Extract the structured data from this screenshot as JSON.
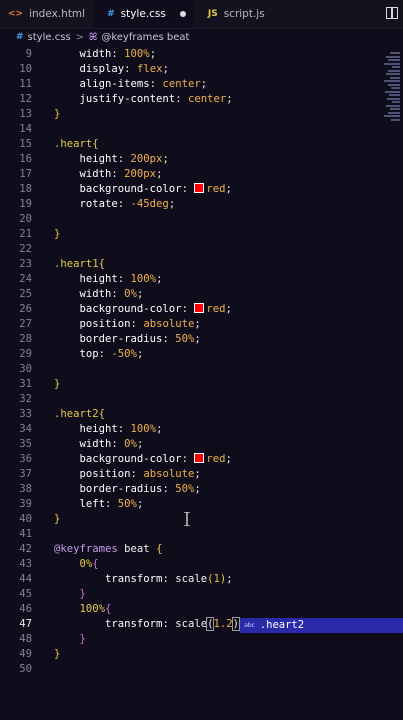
{
  "tabs": [
    {
      "label": "index.html",
      "icon": "html-icon",
      "glyph": "<>"
    },
    {
      "label": "style.css",
      "icon": "css-icon",
      "glyph": "#",
      "active": true,
      "modified": true
    },
    {
      "label": "script.js",
      "icon": "js-icon",
      "glyph": "JS"
    }
  ],
  "breadcrumb": {
    "file_glyph": "#",
    "file": "style.css",
    "separator": ">",
    "symbol_glyph": "ꕤ",
    "symbol": "@keyframes beat"
  },
  "suggestion": {
    "icon_text": "abc",
    "label": ".heart2"
  },
  "lines": [
    {
      "n": "9",
      "parts": [
        [
          "prop",
          "    width"
        ],
        [
          "punc",
          ": "
        ],
        [
          "val",
          "100%"
        ],
        [
          "punc",
          ";"
        ]
      ]
    },
    {
      "n": "10",
      "parts": [
        [
          "prop",
          "    display"
        ],
        [
          "punc",
          ": "
        ],
        [
          "val",
          "flex"
        ],
        [
          "punc",
          ";"
        ]
      ]
    },
    {
      "n": "11",
      "parts": [
        [
          "prop",
          "    align-items"
        ],
        [
          "punc",
          ": "
        ],
        [
          "val",
          "center"
        ],
        [
          "punc",
          ";"
        ]
      ]
    },
    {
      "n": "12",
      "parts": [
        [
          "prop",
          "    justify-content"
        ],
        [
          "punc",
          ": "
        ],
        [
          "val",
          "center"
        ],
        [
          "punc",
          ";"
        ]
      ]
    },
    {
      "n": "13",
      "parts": [
        [
          "brace",
          "}"
        ]
      ]
    },
    {
      "n": "14",
      "parts": []
    },
    {
      "n": "15",
      "parts": [
        [
          "sel",
          ".heart"
        ],
        [
          "brace",
          "{"
        ]
      ]
    },
    {
      "n": "16",
      "parts": [
        [
          "prop",
          "    height"
        ],
        [
          "punc",
          ": "
        ],
        [
          "val",
          "200px"
        ],
        [
          "punc",
          ";"
        ]
      ]
    },
    {
      "n": "17",
      "parts": [
        [
          "prop",
          "    width"
        ],
        [
          "punc",
          ": "
        ],
        [
          "val",
          "200px"
        ],
        [
          "punc",
          ";"
        ]
      ]
    },
    {
      "n": "18",
      "parts": [
        [
          "prop",
          "    background-color"
        ],
        [
          "punc",
          ": "
        ],
        [
          "swatch",
          ""
        ],
        [
          "val",
          "red"
        ],
        [
          "punc",
          ";"
        ]
      ]
    },
    {
      "n": "19",
      "parts": [
        [
          "prop",
          "    rotate"
        ],
        [
          "punc",
          ": "
        ],
        [
          "val",
          "-45deg"
        ],
        [
          "punc",
          ";"
        ]
      ]
    },
    {
      "n": "20",
      "parts": []
    },
    {
      "n": "21",
      "parts": [
        [
          "brace",
          "}"
        ]
      ]
    },
    {
      "n": "22",
      "parts": []
    },
    {
      "n": "23",
      "parts": [
        [
          "sel",
          ".heart1"
        ],
        [
          "brace",
          "{"
        ]
      ]
    },
    {
      "n": "24",
      "parts": [
        [
          "prop",
          "    height"
        ],
        [
          "punc",
          ": "
        ],
        [
          "val",
          "100%"
        ],
        [
          "punc",
          ";"
        ]
      ]
    },
    {
      "n": "25",
      "parts": [
        [
          "prop",
          "    width"
        ],
        [
          "punc",
          ": "
        ],
        [
          "val",
          "0%"
        ],
        [
          "punc",
          ";"
        ]
      ]
    },
    {
      "n": "26",
      "parts": [
        [
          "prop",
          "    background-color"
        ],
        [
          "punc",
          ": "
        ],
        [
          "swatch",
          ""
        ],
        [
          "val",
          "red"
        ],
        [
          "punc",
          ";"
        ]
      ]
    },
    {
      "n": "27",
      "parts": [
        [
          "prop",
          "    position"
        ],
        [
          "punc",
          ": "
        ],
        [
          "val",
          "absolute"
        ],
        [
          "punc",
          ";"
        ]
      ]
    },
    {
      "n": "28",
      "parts": [
        [
          "prop",
          "    border-radius"
        ],
        [
          "punc",
          ": "
        ],
        [
          "val",
          "50%"
        ],
        [
          "punc",
          ";"
        ]
      ]
    },
    {
      "n": "29",
      "parts": [
        [
          "prop",
          "    top"
        ],
        [
          "punc",
          ": "
        ],
        [
          "val",
          "-50%"
        ],
        [
          "punc",
          ";"
        ]
      ]
    },
    {
      "n": "30",
      "parts": []
    },
    {
      "n": "31",
      "parts": [
        [
          "brace",
          "}"
        ]
      ]
    },
    {
      "n": "32",
      "parts": []
    },
    {
      "n": "33",
      "parts": [
        [
          "sel",
          ".heart2"
        ],
        [
          "brace",
          "{"
        ]
      ]
    },
    {
      "n": "34",
      "parts": [
        [
          "prop",
          "    height"
        ],
        [
          "punc",
          ": "
        ],
        [
          "val",
          "100%"
        ],
        [
          "punc",
          ";"
        ]
      ]
    },
    {
      "n": "35",
      "parts": [
        [
          "prop",
          "    width"
        ],
        [
          "punc",
          ": "
        ],
        [
          "val",
          "0%"
        ],
        [
          "punc",
          ";"
        ]
      ]
    },
    {
      "n": "36",
      "parts": [
        [
          "prop",
          "    background-color"
        ],
        [
          "punc",
          ": "
        ],
        [
          "swatch",
          ""
        ],
        [
          "val",
          "red"
        ],
        [
          "punc",
          ";"
        ]
      ]
    },
    {
      "n": "37",
      "parts": [
        [
          "prop",
          "    position"
        ],
        [
          "punc",
          ": "
        ],
        [
          "val",
          "absolute"
        ],
        [
          "punc",
          ";"
        ]
      ]
    },
    {
      "n": "38",
      "parts": [
        [
          "prop",
          "    border-radius"
        ],
        [
          "punc",
          ": "
        ],
        [
          "val",
          "50%"
        ],
        [
          "punc",
          ";"
        ]
      ]
    },
    {
      "n": "39",
      "parts": [
        [
          "prop",
          "    left"
        ],
        [
          "punc",
          ": "
        ],
        [
          "val",
          "50%"
        ],
        [
          "punc",
          ";"
        ]
      ]
    },
    {
      "n": "40",
      "parts": [
        [
          "brace",
          "}"
        ]
      ]
    },
    {
      "n": "41",
      "parts": []
    },
    {
      "n": "42",
      "parts": [
        [
          "kw",
          "@keyframes "
        ],
        [
          "fn",
          "beat "
        ],
        [
          "brace",
          "{"
        ]
      ]
    },
    {
      "n": "43",
      "parts": [
        [
          "pct",
          "    0%"
        ],
        [
          "brace2",
          "{"
        ]
      ]
    },
    {
      "n": "44",
      "parts": [
        [
          "prop",
          "        transform"
        ],
        [
          "punc",
          ": "
        ],
        [
          "fn",
          "scale"
        ],
        [
          "brace",
          "("
        ],
        [
          "val",
          "1"
        ],
        [
          "brace",
          ")"
        ],
        [
          "punc",
          ";"
        ]
      ]
    },
    {
      "n": "45",
      "parts": [
        [
          "brace2",
          "    }"
        ]
      ]
    },
    {
      "n": "46",
      "parts": [
        [
          "pct",
          "    100%"
        ],
        [
          "brace2",
          "{"
        ]
      ]
    },
    {
      "n": "47",
      "parts": [
        [
          "prop",
          "        transform"
        ],
        [
          "punc",
          ": "
        ],
        [
          "fn",
          "scale"
        ],
        [
          "cursorbox",
          "("
        ],
        [
          "val",
          "1.2"
        ],
        [
          "cursorbox",
          ")"
        ],
        [
          "punc",
          ";"
        ]
      ],
      "current": true
    },
    {
      "n": "48",
      "parts": [
        [
          "brace2",
          "    }"
        ]
      ]
    },
    {
      "n": "49",
      "parts": [
        [
          "brace",
          "}"
        ]
      ]
    },
    {
      "n": "50",
      "parts": []
    }
  ]
}
